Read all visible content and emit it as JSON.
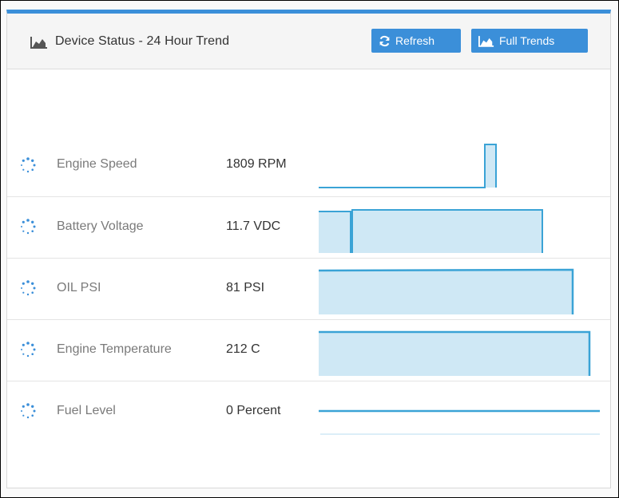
{
  "header": {
    "title": "Device Status - 24 Hour Trend",
    "refresh_label": "Refresh",
    "full_trends_label": "Full Trends",
    "title_icon": "area-chart-icon",
    "refresh_icon": "refresh-icon",
    "trends_icon": "area-chart-icon"
  },
  "colors": {
    "accent": "#3b8fd9",
    "spark_line": "#3aa3d6",
    "spark_fill": "#cfe8f5",
    "label_gray": "#7a7a7a"
  },
  "metrics": [
    {
      "name": "Engine Speed",
      "value": "1809 RPM",
      "icon": "loading-spinner-icon"
    },
    {
      "name": "Battery Voltage",
      "value": "11.7 VDC",
      "icon": "loading-spinner-icon"
    },
    {
      "name": "OIL PSI",
      "value": "81 PSI",
      "icon": "loading-spinner-icon"
    },
    {
      "name": "Engine Temperature",
      "value": "212 C",
      "icon": "loading-spinner-icon"
    },
    {
      "name": "Fuel Level",
      "value": "0 Percent",
      "icon": "loading-spinner-icon"
    }
  ]
}
